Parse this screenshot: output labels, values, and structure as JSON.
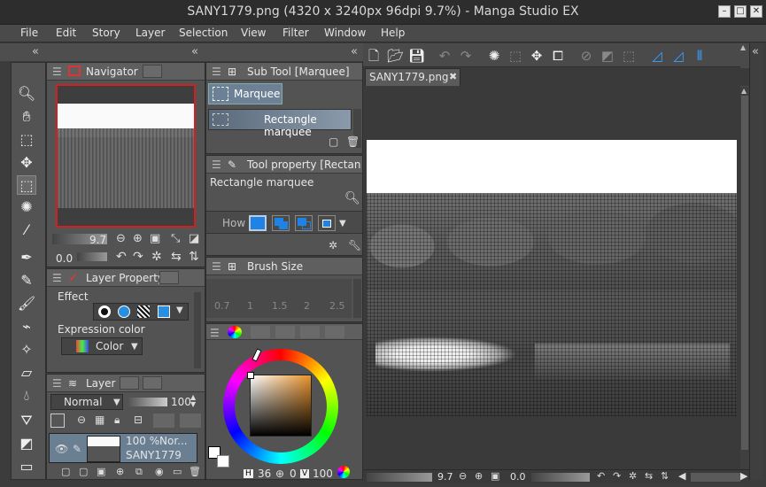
{
  "window": {
    "title": "SANY1779.png (4320 x 3240px 96dpi 9.7%)  - Manga Studio EX"
  },
  "menu": [
    "File",
    "Edit",
    "Story",
    "Layer",
    "Selection",
    "View",
    "Filter",
    "Window",
    "Help"
  ],
  "navigator": {
    "tab_label": "Navigator",
    "zoom_value": "9.7",
    "rotate_value": "0.0"
  },
  "layer_property": {
    "tab_label": "Layer Property",
    "effect_label": "Effect",
    "expression_color_label": "Expression color",
    "expression_color_value": "Color"
  },
  "layer_panel": {
    "tab_label": "Layer",
    "blend_mode": "Normal",
    "opacity": "100",
    "layer_opacity": "100 %",
    "layer_blend": "Nor...",
    "layer_name": "SANY1779"
  },
  "sub_tool": {
    "tab_label": "Sub Tool [Marquee]",
    "group_label": "Marquee",
    "item_label": "Rectangle marquee"
  },
  "tool_property": {
    "tab_label": "Tool property [Rectangl",
    "tool_name": "Rectangle marquee",
    "how_label": "How"
  },
  "brush_size": {
    "tab_label": "Brush Size",
    "sizes": [
      "0.7",
      "1",
      "1.5",
      "2",
      "2.5"
    ]
  },
  "color_panel": {
    "h_label": "H",
    "h_value": "36",
    "s_value": "0",
    "v_label": "V",
    "v_value": "100"
  },
  "document": {
    "tab_label": "SANY1779.png",
    "zoom_value": "9.7",
    "rotate_value": "0.0"
  }
}
